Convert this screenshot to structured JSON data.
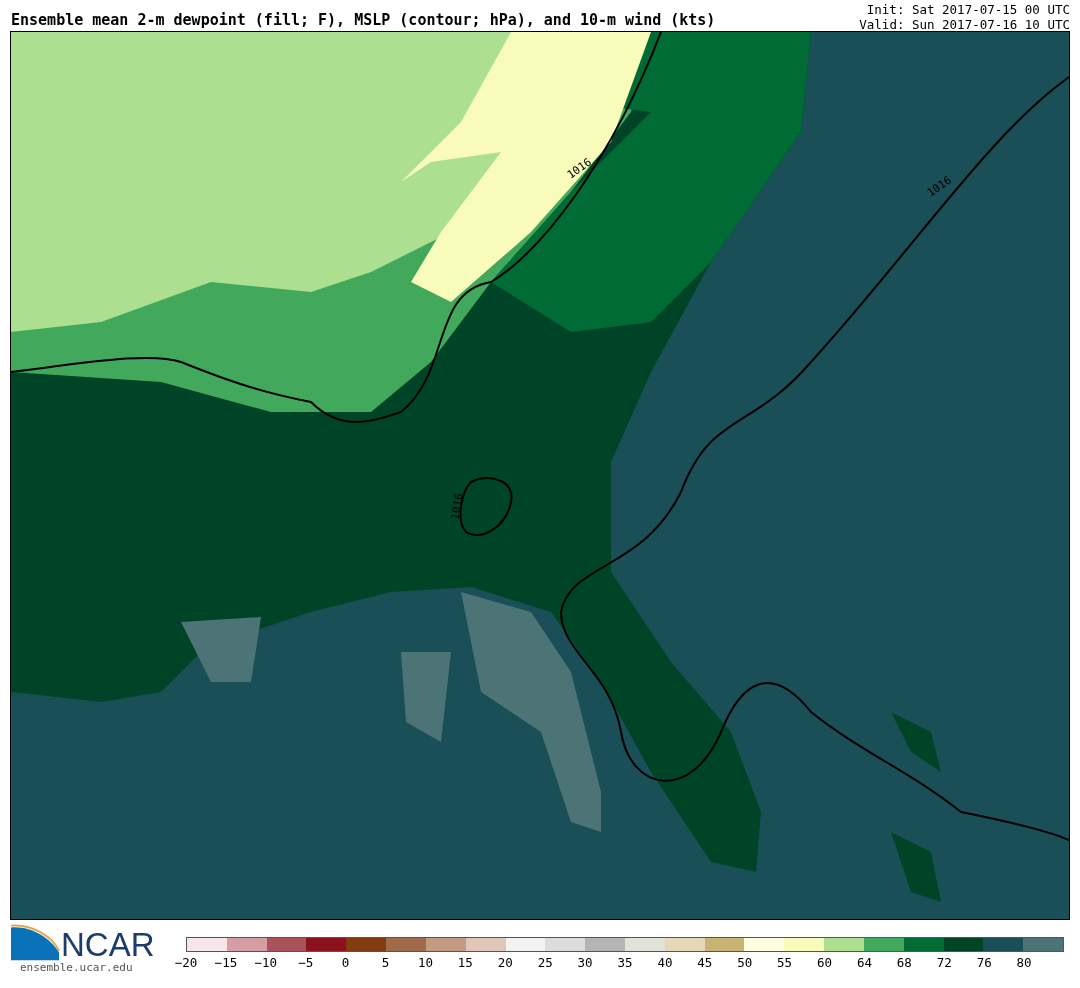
{
  "title": "Ensemble mean 2-m dewpoint (fill; F), MSLP (contour; hPa), and 10-m wind (kts)",
  "init": "Init: Sat 2017-07-15 00 UTC",
  "valid": "Valid: Sun 2017-07-16 10 UTC",
  "map": {
    "contour_labels": [
      "1016",
      "1016",
      "1016"
    ]
  },
  "logo": {
    "text": "NCAR",
    "url": "ensemble.ucar.edu"
  },
  "colorbar": {
    "swatches": [
      {
        "color": "#f5e6ea"
      },
      {
        "color": "#d49ea4"
      },
      {
        "color": "#a9525a"
      },
      {
        "color": "#8b111d"
      },
      {
        "color": "#843b10"
      },
      {
        "color": "#a06a4c"
      },
      {
        "color": "#c49a83"
      },
      {
        "color": "#e0c6b8"
      },
      {
        "color": "#f2f2f2"
      },
      {
        "color": "#dcdcdc"
      },
      {
        "color": "#b4b4b4"
      },
      {
        "color": "#e2e3d8"
      },
      {
        "color": "#e4d8b6"
      },
      {
        "color": "#c8b373"
      },
      {
        "color": "#fefee0"
      },
      {
        "color": "#f8fbb9"
      },
      {
        "color": "#acdf8f"
      },
      {
        "color": "#42a95c"
      },
      {
        "color": "#006b34"
      },
      {
        "color": "#004428"
      },
      {
        "color": "#1a4f57"
      },
      {
        "color": "#4c7477"
      }
    ],
    "ticks": [
      "−20",
      "−15",
      "−10",
      "−5",
      "0",
      "5",
      "10",
      "15",
      "20",
      "25",
      "30",
      "35",
      "40",
      "45",
      "50",
      "55",
      "60",
      "64",
      "68",
      "72",
      "76",
      "80"
    ]
  }
}
